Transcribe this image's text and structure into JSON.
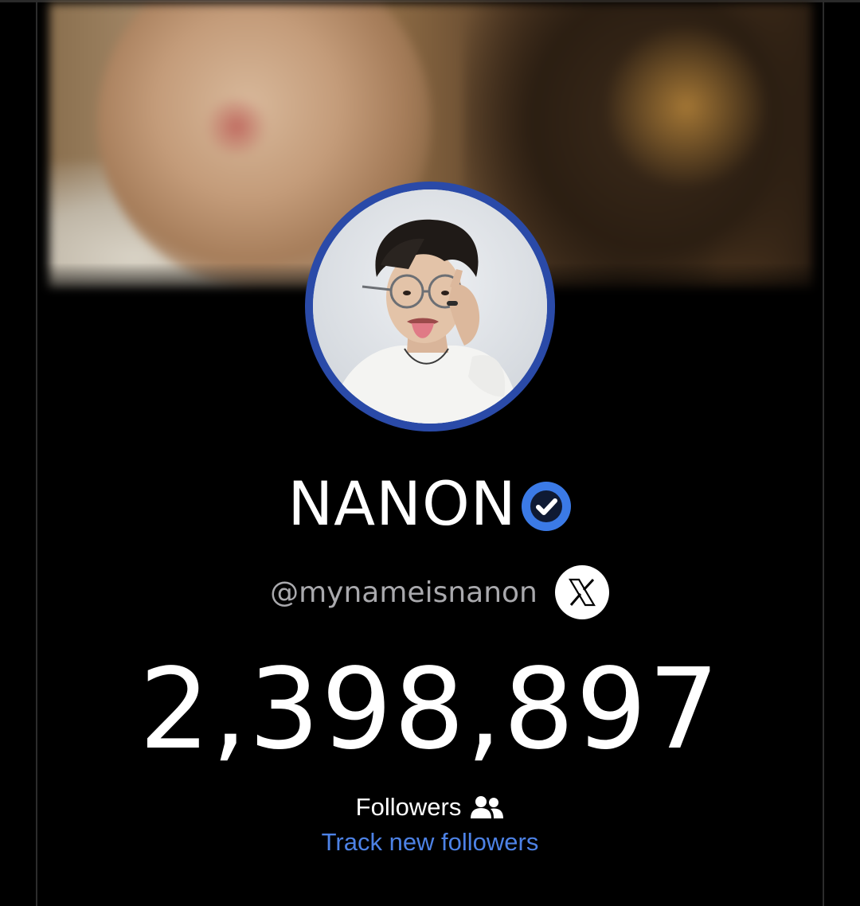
{
  "profile": {
    "name": "NANON",
    "verified": true,
    "handle": "@mynameisnanon",
    "platform_icon": "x-logo-icon"
  },
  "stats": {
    "followers_count": "2,398,897",
    "followers_label": "Followers",
    "followers_icon": "people-icon"
  },
  "actions": {
    "track_label": "Track new followers"
  },
  "colors": {
    "background": "#000000",
    "avatar_ring": "#2a4aa8",
    "verified_badge": "#3b7ae6",
    "link": "#4d82e6",
    "handle": "#a9a9ad"
  }
}
